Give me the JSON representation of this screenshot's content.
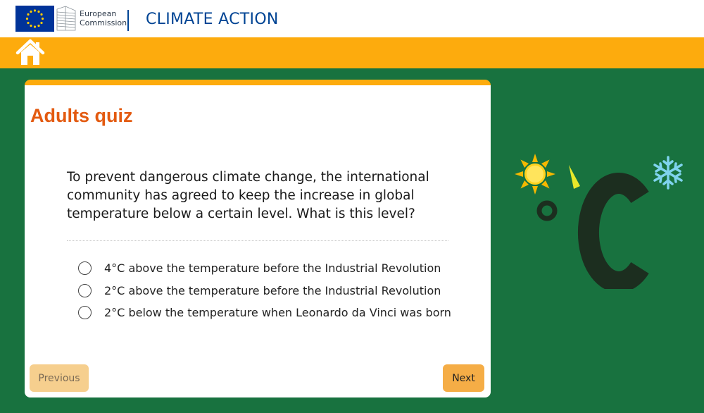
{
  "header": {
    "org_line1": "European",
    "org_line2": "Commission",
    "site_title": "CLIMATE ACTION"
  },
  "nav": {
    "home_icon": "home-icon"
  },
  "quiz": {
    "title": "Adults quiz",
    "question": "To prevent dangerous climate change, the international community has agreed to keep the increase in global temperature below a certain level. What is this level?",
    "options": [
      {
        "label": "4°C above the temperature before the Industrial Revolution"
      },
      {
        "label": "2°C above the temperature before the Industrial Revolution"
      },
      {
        "label": "2°C below the temperature when Leonardo da Vinci was born"
      }
    ],
    "prev_label": "Previous",
    "next_label": "Next"
  },
  "illustration": {
    "symbol": "°C",
    "icons": [
      "sun-icon",
      "snowflake-icon",
      "thermometer-needle-icon"
    ]
  },
  "colors": {
    "background": "#18723f",
    "nav_bar": "#fdab0d",
    "brand_blue": "#004494",
    "quiz_title": "#e35a10",
    "next_button": "#f5ad46",
    "prev_button": "#f6cf8e"
  }
}
